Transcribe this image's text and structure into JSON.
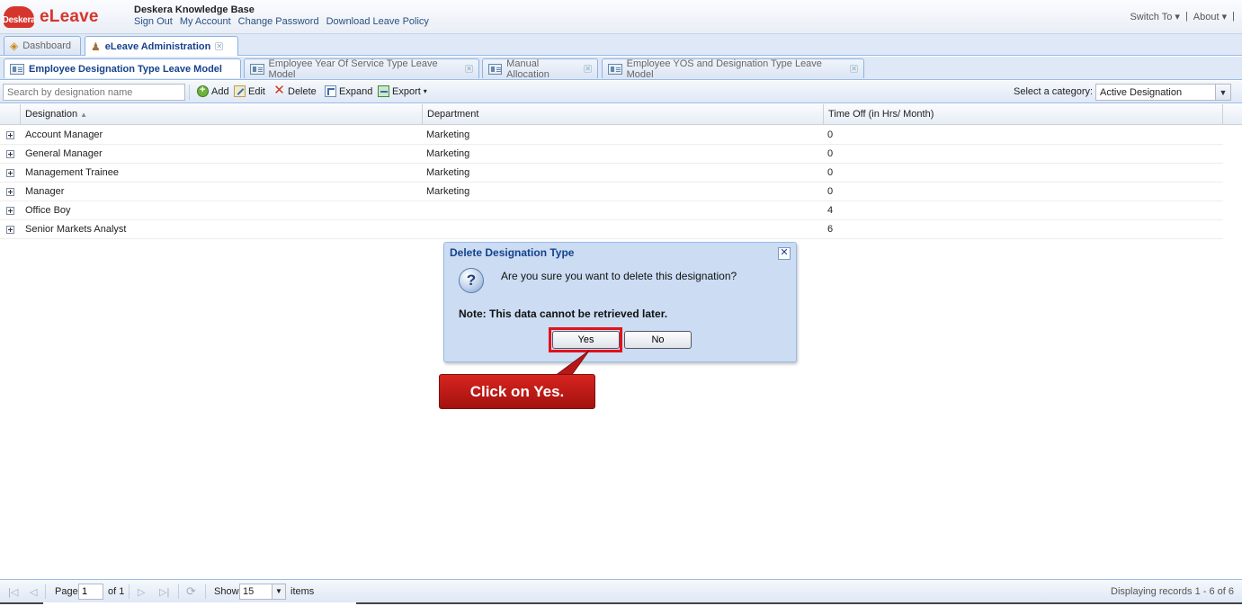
{
  "header": {
    "logo_small": "Deskera",
    "logo_main": "eLeave",
    "kb_title": "Deskera Knowledge Base",
    "links": [
      "Sign Out",
      "My Account",
      "Change Password",
      "Download Leave Policy"
    ],
    "switch_to": "Switch To",
    "about": "About"
  },
  "main_tabs": [
    {
      "label": "Dashboard",
      "icon": "dashboard-icon"
    },
    {
      "label": "eLeave Administration",
      "icon": "user-icon"
    }
  ],
  "sub_tabs": [
    {
      "label": "Employee Designation Type Leave Model"
    },
    {
      "label": "Employee Year Of Service Type Leave Model"
    },
    {
      "label": "Manual Allocation"
    },
    {
      "label": "Employee YOS and Designation Type Leave Model"
    }
  ],
  "toolbar": {
    "search_placeholder": "Search by designation name",
    "add": "Add",
    "edit": "Edit",
    "delete": "Delete",
    "expand": "Expand",
    "export": "Export",
    "category_label": "Select a category:",
    "category_value": "Active Designation"
  },
  "grid": {
    "columns": [
      "Designation",
      "Department",
      "Time Off (in Hrs/ Month)"
    ],
    "rows": [
      {
        "designation": "Account Manager",
        "department": "Marketing",
        "time_off": "0"
      },
      {
        "designation": "General Manager",
        "department": "Marketing",
        "time_off": "0"
      },
      {
        "designation": "Management Trainee",
        "department": "Marketing",
        "time_off": "0"
      },
      {
        "designation": "Manager",
        "department": "Marketing",
        "time_off": "0"
      },
      {
        "designation": "Office Boy",
        "department": "",
        "time_off": "4"
      },
      {
        "designation": "Senior Markets Analyst",
        "department": "",
        "time_off": "6"
      }
    ]
  },
  "dialog": {
    "title": "Delete Designation Type",
    "message": "Are you sure you want to delete this designation?",
    "note": "Note: This data cannot be retrieved later.",
    "yes": "Yes",
    "no": "No"
  },
  "callout": {
    "text": "Click on Yes."
  },
  "paging": {
    "page_label": "Page",
    "page_value": "1",
    "of_label": "of 1",
    "show_label": "Show",
    "show_value": "15",
    "items_label": "items",
    "display_text": "Displaying records 1 - 6 of 6"
  },
  "colors": {
    "brand": "#d5352d",
    "accent": "#15428b",
    "callout": "#c81e1a"
  }
}
